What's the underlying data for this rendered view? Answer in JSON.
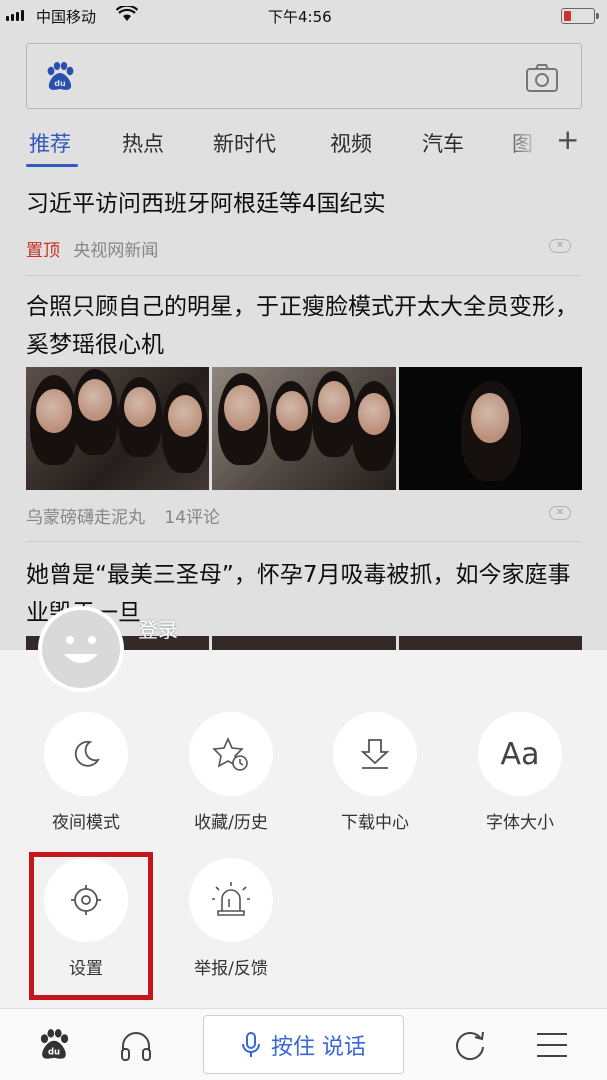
{
  "status_bar": {
    "carrier": "中国移动",
    "time": "下午4:56",
    "battery_level": 0.25,
    "battery_color": "#e53935"
  },
  "search": {
    "logo_icon": "baidu-paw-icon",
    "camera_icon": "camera-icon"
  },
  "tabs": {
    "items": [
      {
        "label": "推荐",
        "active": true
      },
      {
        "label": "热点"
      },
      {
        "label": "新时代"
      },
      {
        "label": "视频"
      },
      {
        "label": "汽车"
      },
      {
        "label": "图"
      }
    ],
    "add_label": "+",
    "accent_color": "#3a66d8"
  },
  "feed": [
    {
      "title": "习近平访问西班牙阿根廷等4国纪实",
      "tag": "置顶",
      "source": "央视网新闻"
    },
    {
      "title": "合照只顾自己的明星，于正瘦脸模式开太大全员变形，奚梦瑶很心机",
      "source": "乌蒙磅礴走泥丸",
      "comments": "14评论"
    },
    {
      "title": "她曾是“最美三圣母”，怀孕7月吸毒被抓，如今家庭事业毁于一旦"
    }
  ],
  "menu": {
    "login_label": "登录",
    "items": [
      {
        "label": "夜间模式",
        "icon": "moon-icon"
      },
      {
        "label": "收藏/历史",
        "icon": "star-history-icon"
      },
      {
        "label": "下载中心",
        "icon": "download-icon"
      },
      {
        "label": "字体大小",
        "icon": "font-size-icon",
        "glyph": "Aa"
      },
      {
        "label": "设置",
        "icon": "settings-gear-icon",
        "highlighted": true
      },
      {
        "label": "举报/反馈",
        "icon": "alarm-report-icon"
      }
    ],
    "highlight_color": "#c4161c"
  },
  "bottom_bar": {
    "voice_label": "按住 说话",
    "icons": [
      "baidu-home-icon",
      "headphones-icon",
      "microphone-icon",
      "refresh-icon",
      "menu-icon"
    ]
  }
}
